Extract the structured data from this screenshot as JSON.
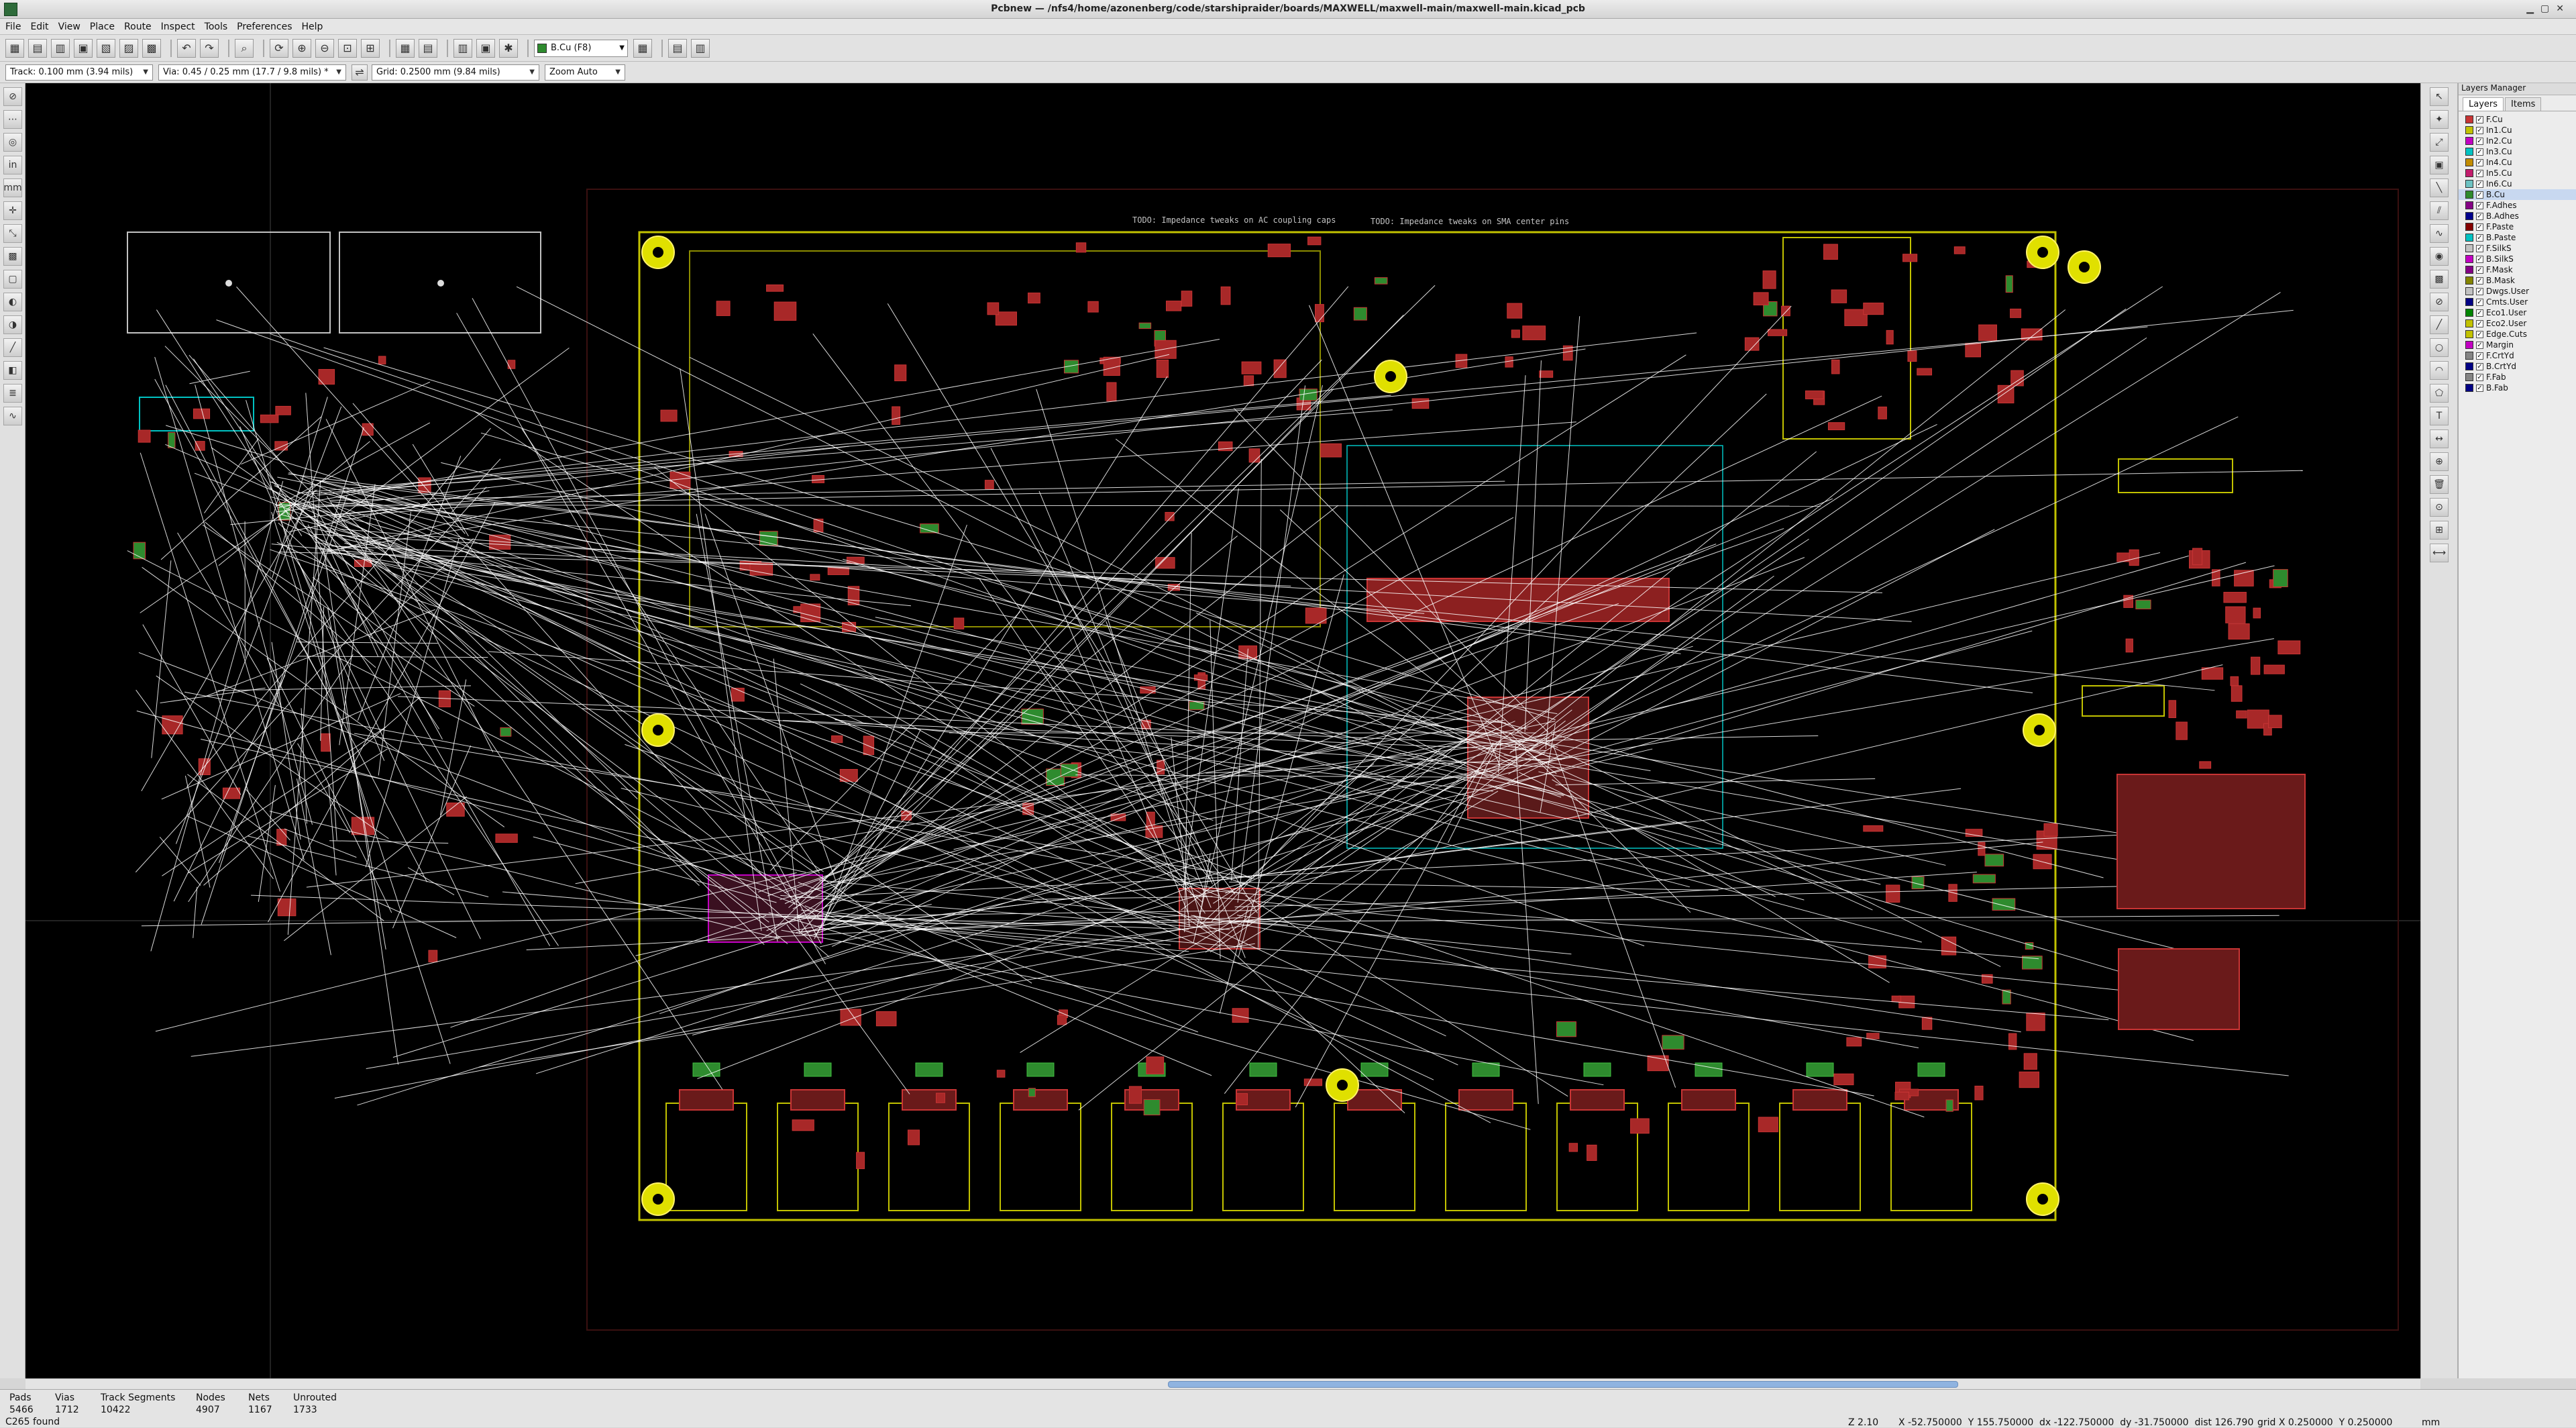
{
  "window": {
    "title": "Pcbnew — /nfs4/home/azonenberg/code/starshipraider/boards/MAXWELL/maxwell-main/maxwell-main.kicad_pcb"
  },
  "menu": [
    "File",
    "Edit",
    "View",
    "Place",
    "Route",
    "Inspect",
    "Tools",
    "Preferences",
    "Help"
  ],
  "toolbar": {
    "active_layer": "B.Cu (F8)"
  },
  "options_bar": {
    "track": "Track: 0.100 mm (3.94 mils)",
    "via": "Via: 0.45 / 0.25 mm (17.7 / 9.8 mils) *",
    "grid": "Grid: 0.2500 mm (9.84 mils)",
    "zoom": "Zoom Auto"
  },
  "layers_manager": {
    "title": "Layers Manager",
    "tabs": [
      "Layers",
      "Items"
    ],
    "active_tab": "Layers",
    "layers": [
      {
        "name": "F.Cu",
        "color": "#c83434",
        "checked": true,
        "active": false
      },
      {
        "name": "In1.Cu",
        "color": "#c2c200",
        "checked": true,
        "active": false
      },
      {
        "name": "In2.Cu",
        "color": "#c200c2",
        "checked": true,
        "active": false
      },
      {
        "name": "In3.Cu",
        "color": "#00c2c2",
        "checked": true,
        "active": false
      },
      {
        "name": "In4.Cu",
        "color": "#c28c00",
        "checked": true,
        "active": false
      },
      {
        "name": "In5.Cu",
        "color": "#c21c6c",
        "checked": true,
        "active": false
      },
      {
        "name": "In6.Cu",
        "color": "#6cc2c2",
        "checked": true,
        "active": false
      },
      {
        "name": "B.Cu",
        "color": "#2e8b2e",
        "checked": true,
        "active": true
      },
      {
        "name": "F.Adhes",
        "color": "#840084",
        "checked": true,
        "active": false
      },
      {
        "name": "B.Adhes",
        "color": "#00008c",
        "checked": true,
        "active": false
      },
      {
        "name": "F.Paste",
        "color": "#840000",
        "checked": true,
        "active": false
      },
      {
        "name": "B.Paste",
        "color": "#00c2c2",
        "checked": true,
        "active": false
      },
      {
        "name": "F.SilkS",
        "color": "#c2c2c2",
        "checked": true,
        "active": false
      },
      {
        "name": "B.SilkS",
        "color": "#c200c2",
        "checked": true,
        "active": false
      },
      {
        "name": "F.Mask",
        "color": "#840084",
        "checked": true,
        "active": false
      },
      {
        "name": "B.Mask",
        "color": "#848400",
        "checked": true,
        "active": false
      },
      {
        "name": "Dwgs.User",
        "color": "#c2c2c2",
        "checked": true,
        "active": false
      },
      {
        "name": "Cmts.User",
        "color": "#000084",
        "checked": true,
        "active": false
      },
      {
        "name": "Eco1.User",
        "color": "#008400",
        "checked": true,
        "active": false
      },
      {
        "name": "Eco2.User",
        "color": "#c2c200",
        "checked": true,
        "active": false
      },
      {
        "name": "Edge.Cuts",
        "color": "#c2c200",
        "checked": true,
        "active": false
      },
      {
        "name": "Margin",
        "color": "#c200c2",
        "checked": true,
        "active": false
      },
      {
        "name": "F.CrtYd",
        "color": "#848484",
        "checked": true,
        "active": false
      },
      {
        "name": "B.CrtYd",
        "color": "#000084",
        "checked": true,
        "active": false
      },
      {
        "name": "F.Fab",
        "color": "#848484",
        "checked": true,
        "active": false
      },
      {
        "name": "B.Fab",
        "color": "#000084",
        "checked": true,
        "active": false
      }
    ]
  },
  "canvas": {
    "todo_notes": [
      "TODO: Impedance tweaks on AC coupling caps",
      "TODO: Impedance tweaks on SMA center pins"
    ],
    "colors": {
      "background": "#000000",
      "edge": "#c2c200",
      "ratsnest": "#ffffff",
      "pad": "#c83434",
      "bcu": "#2e8b2e",
      "silk": "#00c2c2",
      "hole": "#e0e000"
    }
  },
  "status": {
    "pads_label": "Pads",
    "pads": "5466",
    "vias_label": "Vias",
    "vias": "1712",
    "tracks_label": "Track Segments",
    "tracks": "10422",
    "nodes_label": "Nodes",
    "nodes": "4907",
    "nets_label": "Nets",
    "nets": "1167",
    "unrouted_label": "Unrouted",
    "unrouted": "1733",
    "message": "C265 found",
    "zoom": "Z 2.10",
    "xy": "X -52.750000  Y 155.750000",
    "dxy": "dx -122.750000  dy -31.750000  dist 126.790",
    "grid": "grid X 0.250000  Y 0.250000",
    "units": "mm"
  }
}
